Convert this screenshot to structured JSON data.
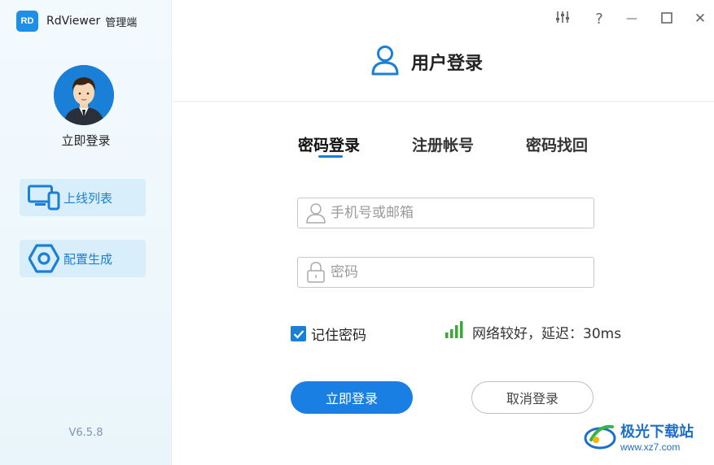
{
  "app": {
    "logo_text": "RD",
    "name": "RdViewer",
    "subtitle": "管理端",
    "version": "V6.5.8"
  },
  "sidebar": {
    "login_label": "立即登录",
    "items": [
      {
        "label": "上线列表",
        "icon": "devices-icon"
      },
      {
        "label": "配置生成",
        "icon": "hexagon-config-icon"
      }
    ]
  },
  "window_controls": {
    "settings_icon": "sliders-icon",
    "help_icon": "question-icon",
    "minimize_icon": "minimize-icon",
    "maximize_icon": "maximize-icon",
    "close_icon": "close-icon",
    "help_glyph": "?",
    "minimize_glyph": "—",
    "close_glyph": "✕"
  },
  "header": {
    "title": "用户登录",
    "icon": "user-icon"
  },
  "tabs": [
    {
      "label": "密码登录",
      "active": true
    },
    {
      "label": "注册帐号",
      "active": false
    },
    {
      "label": "密码找回",
      "active": false
    }
  ],
  "form": {
    "account": {
      "placeholder": "手机号或邮箱",
      "value": ""
    },
    "password": {
      "placeholder": "密码",
      "value": ""
    },
    "remember_label": "记住密码",
    "remember_checked": true,
    "network_status": "网络较好，延迟：30ms",
    "login_button": "立即登录",
    "cancel_button": "取消登录"
  },
  "watermark": {
    "title": "极光下载站",
    "url": "www.xz7.com"
  },
  "colors": {
    "accent": "#1a7fe3",
    "sidebar_bg": "#eef7fc",
    "signal_green": "#3aa935"
  }
}
